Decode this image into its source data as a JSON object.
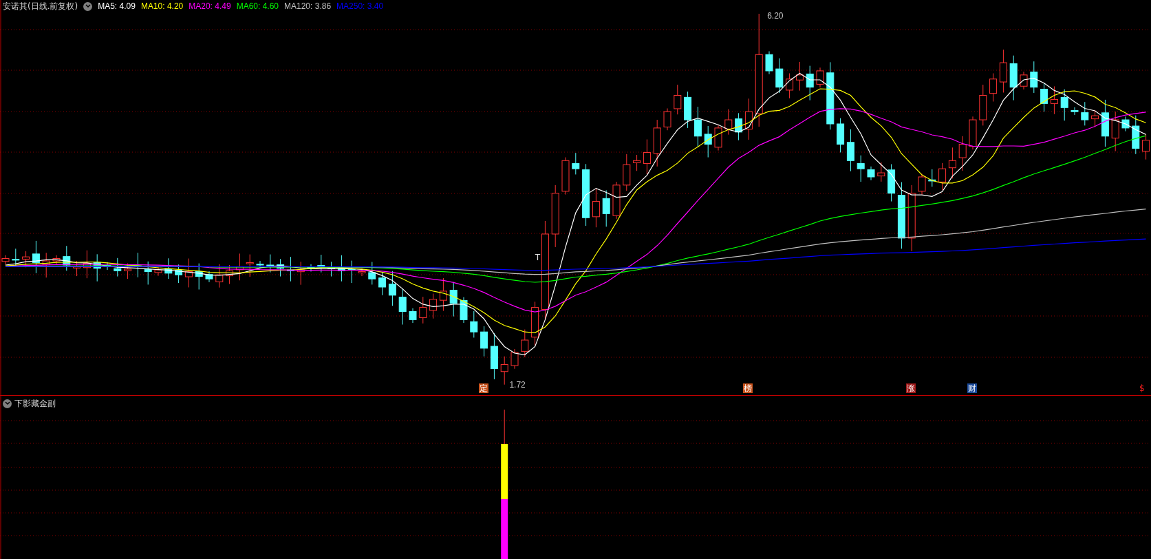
{
  "main_pane": {
    "title": "安诺其(日线.前复权)",
    "moving_averages": [
      {
        "label": "MA5: 4.09",
        "color": "#ffffff"
      },
      {
        "label": "MA10: 4.20",
        "color": "#ffff00"
      },
      {
        "label": "MA20: 4.49",
        "color": "#ff00ff"
      },
      {
        "label": "MA60: 4.60",
        "color": "#00ff00"
      },
      {
        "label": "MA120: 3.86",
        "color": "#c0c0c0"
      },
      {
        "label": "MA250: 3.40",
        "color": "#0000ff"
      }
    ],
    "high_label": "6.20",
    "low_label": "1.72",
    "signal_text": "T",
    "markers": [
      {
        "label": "定",
        "kind": "badge",
        "color": "#c8521c"
      },
      {
        "label": "榜",
        "kind": "badge",
        "color": "#c8521c"
      },
      {
        "label": "涨",
        "kind": "badge",
        "color": "#a01818"
      },
      {
        "label": "财",
        "kind": "badge",
        "color": "#1a4a9a"
      },
      {
        "label": "$",
        "kind": "text",
        "color": "#ff2020"
      }
    ]
  },
  "sub_pane": {
    "title": "下影藏金副"
  }
}
